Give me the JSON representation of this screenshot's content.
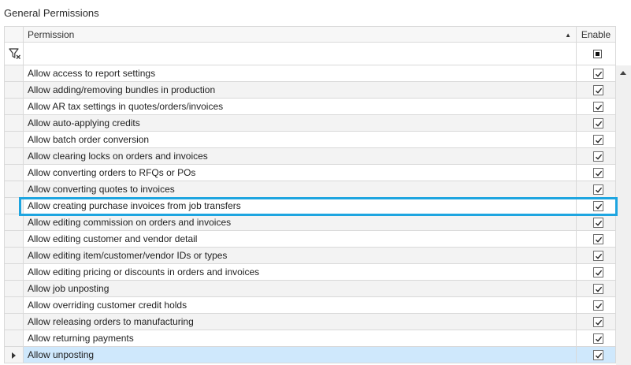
{
  "section_title": "General Permissions",
  "columns": {
    "permission": "Permission",
    "enable": "Enable"
  },
  "colors": {
    "highlight": "#1ea5e0",
    "current_row": "#cfe8fc"
  },
  "icons": {
    "filter_clear": "filter-clear-icon",
    "sort": "sort-ascending-icon",
    "row_indicator": "row-pointer-icon"
  },
  "permissions": [
    {
      "label": "Allow access to report settings",
      "enabled": true
    },
    {
      "label": "Allow adding/removing bundles in production",
      "enabled": true
    },
    {
      "label": "Allow AR tax settings in quotes/orders/invoices",
      "enabled": true
    },
    {
      "label": "Allow auto-applying credits",
      "enabled": true
    },
    {
      "label": "Allow batch order conversion",
      "enabled": true
    },
    {
      "label": "Allow clearing locks on orders and invoices",
      "enabled": true
    },
    {
      "label": "Allow converting orders to RFQs or POs",
      "enabled": true
    },
    {
      "label": "Allow converting quotes to invoices",
      "enabled": true
    },
    {
      "label": "Allow creating purchase invoices from job transfers",
      "enabled": true,
      "highlighted": true
    },
    {
      "label": "Allow editing commission on orders and invoices",
      "enabled": true
    },
    {
      "label": "Allow editing customer and vendor detail",
      "enabled": true
    },
    {
      "label": "Allow editing item/customer/vendor IDs or types",
      "enabled": true
    },
    {
      "label": "Allow editing pricing or discounts in orders and invoices",
      "enabled": true
    },
    {
      "label": "Allow job unposting",
      "enabled": true
    },
    {
      "label": "Allow overriding customer credit holds",
      "enabled": true
    },
    {
      "label": "Allow releasing orders to manufacturing",
      "enabled": true
    },
    {
      "label": "Allow returning payments",
      "enabled": true
    },
    {
      "label": "Allow unposting",
      "enabled": true,
      "current": true
    }
  ]
}
